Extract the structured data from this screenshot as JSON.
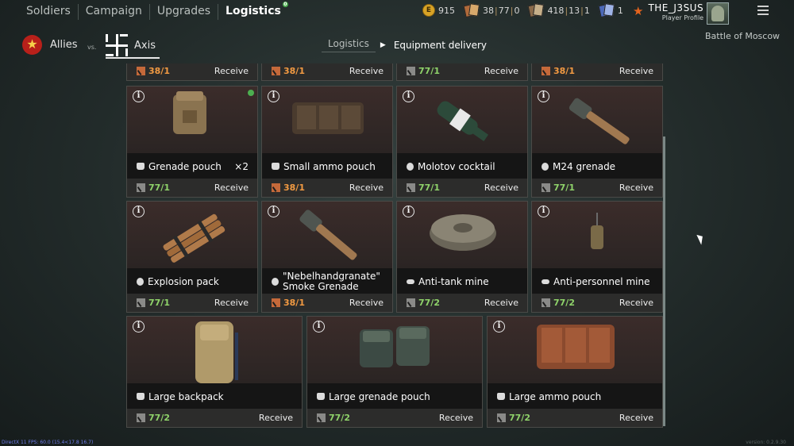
{
  "nav": {
    "tabs": [
      {
        "label": "Soldiers"
      },
      {
        "label": "Campaign"
      },
      {
        "label": "Upgrades"
      },
      {
        "label": "Logistics",
        "badge": "0"
      }
    ]
  },
  "resources": {
    "coins": "915",
    "coin_symbol": "E",
    "res1": {
      "a": "38",
      "b": "77",
      "c": "0"
    },
    "res2": {
      "a": "418",
      "b": "13",
      "c": "1"
    },
    "res3": "1"
  },
  "profile": {
    "name": "THE_J3SUS",
    "subtitle": "Player Profile",
    "battle": "Battle of Moscow"
  },
  "factions": {
    "allies": "Allies",
    "vs": "vs.",
    "axis": "Axis"
  },
  "breadcrumb": {
    "first": "Logistics",
    "second": "Equipment delivery"
  },
  "receive_label": "Receive",
  "top_row": [
    {
      "rank": "38/1",
      "rank_color": "orange"
    },
    {
      "rank": "38/1",
      "rank_color": "orange"
    },
    {
      "rank": "77/1",
      "rank_color": "green"
    },
    {
      "rank": "38/1",
      "rank_color": "orange"
    }
  ],
  "items": [
    {
      "name": "Grenade pouch",
      "count": "×2",
      "rank": "77/1",
      "rank_color": "green",
      "icon": "pouch-icon",
      "new": true
    },
    {
      "name": "Small ammo pouch",
      "count": "",
      "rank": "38/1",
      "rank_color": "orange",
      "icon": "pouch-icon"
    },
    {
      "name": "Molotov cocktail",
      "count": "",
      "rank": "77/1",
      "rank_color": "green",
      "icon": "grenade-icon"
    },
    {
      "name": "M24 grenade",
      "count": "",
      "rank": "77/1",
      "rank_color": "green",
      "icon": "grenade-icon"
    },
    {
      "name": "Explosion pack",
      "count": "",
      "rank": "77/1",
      "rank_color": "green",
      "icon": "grenade-icon"
    },
    {
      "name": "\"Nebelhandgranate\" Smoke Grenade",
      "count": "",
      "rank": "38/1",
      "rank_color": "orange",
      "icon": "grenade-icon"
    },
    {
      "name": "Anti-tank mine",
      "count": "",
      "rank": "77/2",
      "rank_color": "green",
      "icon": "mine-icon"
    },
    {
      "name": "Anti-personnel mine",
      "count": "",
      "rank": "77/2",
      "rank_color": "green",
      "icon": "mine-icon"
    },
    {
      "name": "Large backpack",
      "count": "",
      "rank": "77/2",
      "rank_color": "green",
      "icon": "pouch-icon"
    },
    {
      "name": "Large grenade pouch",
      "count": "",
      "rank": "77/2",
      "rank_color": "green",
      "icon": "pouch-icon"
    },
    {
      "name": "Large ammo pouch",
      "count": "",
      "rank": "77/2",
      "rank_color": "green",
      "icon": "pouch-icon"
    }
  ],
  "status": {
    "left": "DirectX 11 FPS: 60.0 (15.4<17.8 16.7)",
    "right": "version: 0.2.9.30"
  },
  "colors": {
    "green": "#8fd36a",
    "orange": "#f29a42",
    "accent": "#b8201a"
  }
}
